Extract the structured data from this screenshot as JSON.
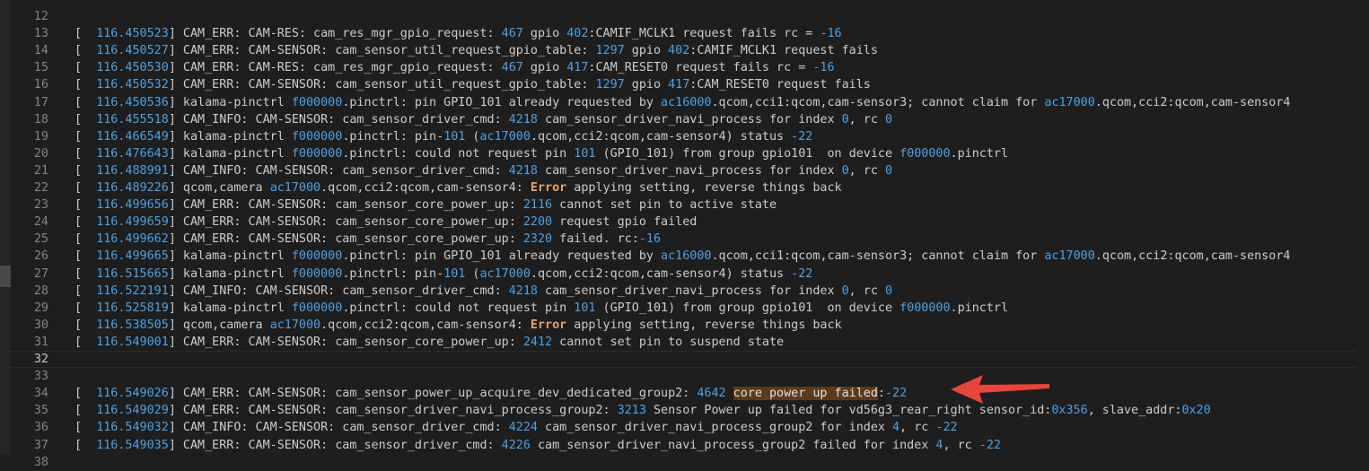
{
  "editor": {
    "lines": [
      {
        "n": "12",
        "segs": []
      },
      {
        "n": "13",
        "segs": [
          [
            "[  ",
            "t"
          ],
          [
            "116.450523",
            "n"
          ],
          [
            "] CAM_ERR: CAM-RES: cam_res_mgr_gpio_request: ",
            "t"
          ],
          [
            "467",
            "n"
          ],
          [
            " gpio ",
            "t"
          ],
          [
            "402",
            "n"
          ],
          [
            ":CAMIF_MCLK1 request fails rc = ",
            "t"
          ],
          [
            "-16",
            "n"
          ]
        ]
      },
      {
        "n": "14",
        "segs": [
          [
            "[  ",
            "t"
          ],
          [
            "116.450527",
            "n"
          ],
          [
            "] CAM_ERR: CAM-SENSOR: cam_sensor_util_request_gpio_table: ",
            "t"
          ],
          [
            "1297",
            "n"
          ],
          [
            " gpio ",
            "t"
          ],
          [
            "402",
            "n"
          ],
          [
            ":CAMIF_MCLK1 request fails",
            "t"
          ]
        ]
      },
      {
        "n": "15",
        "segs": [
          [
            "[  ",
            "t"
          ],
          [
            "116.450530",
            "n"
          ],
          [
            "] CAM_ERR: CAM-RES: cam_res_mgr_gpio_request: ",
            "t"
          ],
          [
            "467",
            "n"
          ],
          [
            " gpio ",
            "t"
          ],
          [
            "417",
            "n"
          ],
          [
            ":CAM_RESET0 request fails rc = ",
            "t"
          ],
          [
            "-16",
            "n"
          ]
        ]
      },
      {
        "n": "16",
        "segs": [
          [
            "[  ",
            "t"
          ],
          [
            "116.450532",
            "n"
          ],
          [
            "] CAM_ERR: CAM-SENSOR: cam_sensor_util_request_gpio_table: ",
            "t"
          ],
          [
            "1297",
            "n"
          ],
          [
            " gpio ",
            "t"
          ],
          [
            "417",
            "n"
          ],
          [
            ":CAM_RESET0 request fails",
            "t"
          ]
        ]
      },
      {
        "n": "17",
        "segs": [
          [
            "[  ",
            "t"
          ],
          [
            "116.450536",
            "n"
          ],
          [
            "] kalama-pinctrl ",
            "t"
          ],
          [
            "f000000",
            "n"
          ],
          [
            ".pinctrl: pin GPIO_101 already requested by ",
            "t"
          ],
          [
            "ac16000",
            "n"
          ],
          [
            ".qcom,cci1:qcom,cam-sensor3; cannot claim for ",
            "t"
          ],
          [
            "ac17000",
            "n"
          ],
          [
            ".qcom,cci2:qcom,cam-sensor4",
            "t"
          ]
        ]
      },
      {
        "n": "18",
        "segs": [
          [
            "[  ",
            "t"
          ],
          [
            "116.455518",
            "n"
          ],
          [
            "] CAM_INFO: CAM-SENSOR: cam_sensor_driver_cmd: ",
            "t"
          ],
          [
            "4218",
            "n"
          ],
          [
            " cam_sensor_driver_navi_process for index ",
            "t"
          ],
          [
            "0",
            "n"
          ],
          [
            ", rc ",
            "t"
          ],
          [
            "0",
            "n"
          ]
        ]
      },
      {
        "n": "19",
        "segs": [
          [
            "[  ",
            "t"
          ],
          [
            "116.466549",
            "n"
          ],
          [
            "] kalama-pinctrl ",
            "t"
          ],
          [
            "f000000",
            "n"
          ],
          [
            ".pinctrl: pin-",
            "t"
          ],
          [
            "101",
            "n"
          ],
          [
            " (",
            "t"
          ],
          [
            "ac17000",
            "n"
          ],
          [
            ".qcom,cci2:qcom,cam-sensor4) status ",
            "t"
          ],
          [
            "-22",
            "n"
          ]
        ]
      },
      {
        "n": "20",
        "segs": [
          [
            "[  ",
            "t"
          ],
          [
            "116.476643",
            "n"
          ],
          [
            "] kalama-pinctrl ",
            "t"
          ],
          [
            "f000000",
            "n"
          ],
          [
            ".pinctrl: could not request pin ",
            "t"
          ],
          [
            "101",
            "n"
          ],
          [
            " (GPIO_101) from group gpio101  on device ",
            "t"
          ],
          [
            "f000000",
            "n"
          ],
          [
            ".pinctrl",
            "t"
          ]
        ]
      },
      {
        "n": "21",
        "segs": [
          [
            "[  ",
            "t"
          ],
          [
            "116.488991",
            "n"
          ],
          [
            "] CAM_INFO: CAM-SENSOR: cam_sensor_driver_cmd: ",
            "t"
          ],
          [
            "4218",
            "n"
          ],
          [
            " cam_sensor_driver_navi_process for index ",
            "t"
          ],
          [
            "0",
            "n"
          ],
          [
            ", rc ",
            "t"
          ],
          [
            "0",
            "n"
          ]
        ]
      },
      {
        "n": "22",
        "segs": [
          [
            "[  ",
            "t"
          ],
          [
            "116.489226",
            "n"
          ],
          [
            "] qcom,camera ",
            "t"
          ],
          [
            "ac17000",
            "n"
          ],
          [
            ".qcom,cci2:qcom,cam-sensor4: ",
            "t"
          ],
          [
            "Error",
            "e"
          ],
          [
            " applying setting, reverse things back",
            "t"
          ]
        ]
      },
      {
        "n": "23",
        "segs": [
          [
            "[  ",
            "t"
          ],
          [
            "116.499656",
            "n"
          ],
          [
            "] CAM_ERR: CAM-SENSOR: cam_sensor_core_power_up: ",
            "t"
          ],
          [
            "2116",
            "n"
          ],
          [
            " cannot set pin to active state",
            "t"
          ]
        ]
      },
      {
        "n": "24",
        "segs": [
          [
            "[  ",
            "t"
          ],
          [
            "116.499659",
            "n"
          ],
          [
            "] CAM_ERR: CAM-SENSOR: cam_sensor_core_power_up: ",
            "t"
          ],
          [
            "2200",
            "n"
          ],
          [
            " request gpio failed",
            "t"
          ]
        ]
      },
      {
        "n": "25",
        "segs": [
          [
            "[  ",
            "t"
          ],
          [
            "116.499662",
            "n"
          ],
          [
            "] CAM_ERR: CAM-SENSOR: cam_sensor_core_power_up: ",
            "t"
          ],
          [
            "2320",
            "n"
          ],
          [
            " failed. rc:",
            "t"
          ],
          [
            "-16",
            "n"
          ]
        ]
      },
      {
        "n": "26",
        "segs": [
          [
            "[  ",
            "t"
          ],
          [
            "116.499665",
            "n"
          ],
          [
            "] kalama-pinctrl ",
            "t"
          ],
          [
            "f000000",
            "n"
          ],
          [
            ".pinctrl: pin GPIO_101 already requested by ",
            "t"
          ],
          [
            "ac16000",
            "n"
          ],
          [
            ".qcom,cci1:qcom,cam-sensor3; cannot claim for ",
            "t"
          ],
          [
            "ac17000",
            "n"
          ],
          [
            ".qcom,cci2:qcom,cam-sensor4",
            "t"
          ]
        ]
      },
      {
        "n": "27",
        "segs": [
          [
            "[  ",
            "t"
          ],
          [
            "116.515665",
            "n"
          ],
          [
            "] kalama-pinctrl ",
            "t"
          ],
          [
            "f000000",
            "n"
          ],
          [
            ".pinctrl: pin-",
            "t"
          ],
          [
            "101",
            "n"
          ],
          [
            " (",
            "t"
          ],
          [
            "ac17000",
            "n"
          ],
          [
            ".qcom,cci2:qcom,cam-sensor4) status ",
            "t"
          ],
          [
            "-22",
            "n"
          ]
        ]
      },
      {
        "n": "28",
        "segs": [
          [
            "[  ",
            "t"
          ],
          [
            "116.522191",
            "n"
          ],
          [
            "] CAM_INFO: CAM-SENSOR: cam_sensor_driver_cmd: ",
            "t"
          ],
          [
            "4218",
            "n"
          ],
          [
            " cam_sensor_driver_navi_process for index ",
            "t"
          ],
          [
            "0",
            "n"
          ],
          [
            ", rc ",
            "t"
          ],
          [
            "0",
            "n"
          ]
        ]
      },
      {
        "n": "29",
        "segs": [
          [
            "[  ",
            "t"
          ],
          [
            "116.525819",
            "n"
          ],
          [
            "] kalama-pinctrl ",
            "t"
          ],
          [
            "f000000",
            "n"
          ],
          [
            ".pinctrl: could not request pin ",
            "t"
          ],
          [
            "101",
            "n"
          ],
          [
            " (GPIO_101) from group gpio101  on device ",
            "t"
          ],
          [
            "f000000",
            "n"
          ],
          [
            ".pinctrl",
            "t"
          ]
        ]
      },
      {
        "n": "30",
        "segs": [
          [
            "[  ",
            "t"
          ],
          [
            "116.538505",
            "n"
          ],
          [
            "] qcom,camera ",
            "t"
          ],
          [
            "ac17000",
            "n"
          ],
          [
            ".qcom,cci2:qcom,cam-sensor4: ",
            "t"
          ],
          [
            "Error",
            "e"
          ],
          [
            " applying setting, reverse things back",
            "t"
          ]
        ]
      },
      {
        "n": "31",
        "segs": [
          [
            "[  ",
            "t"
          ],
          [
            "116.549001",
            "n"
          ],
          [
            "] CAM_ERR: CAM-SENSOR: cam_sensor_core_power_up: ",
            "t"
          ],
          [
            "2412",
            "n"
          ],
          [
            " cannot set pin to suspend state",
            "t"
          ]
        ]
      },
      {
        "n": "32",
        "segs": [],
        "current": true
      },
      {
        "n": "33",
        "segs": []
      },
      {
        "n": "34",
        "segs": [
          [
            "[  ",
            "t"
          ],
          [
            "116.549026",
            "n"
          ],
          [
            "] CAM_ERR: CAM-SENSOR: cam_sensor_power_up_acquire_dev_dedicated_group2: ",
            "t"
          ],
          [
            "4642",
            "n"
          ],
          [
            " ",
            "t"
          ],
          [
            "core power up failed",
            "h"
          ],
          [
            ":",
            "t"
          ],
          [
            "-22",
            "n"
          ]
        ]
      },
      {
        "n": "35",
        "segs": [
          [
            "[  ",
            "t"
          ],
          [
            "116.549029",
            "n"
          ],
          [
            "] CAM_ERR: CAM-SENSOR: cam_sensor_driver_navi_process_group2: ",
            "t"
          ],
          [
            "3213",
            "n"
          ],
          [
            " Sensor Power up failed for vd56g3_rear_right sensor_id:",
            "t"
          ],
          [
            "0x356",
            "n"
          ],
          [
            ", slave_addr:",
            "t"
          ],
          [
            "0x20",
            "n"
          ]
        ]
      },
      {
        "n": "36",
        "segs": [
          [
            "[  ",
            "t"
          ],
          [
            "116.549032",
            "n"
          ],
          [
            "] CAM_INFO: CAM-SENSOR: cam_sensor_driver_cmd: ",
            "t"
          ],
          [
            "4224",
            "n"
          ],
          [
            " cam_sensor_driver_navi_process_group2 for index ",
            "t"
          ],
          [
            "4",
            "n"
          ],
          [
            ", rc ",
            "t"
          ],
          [
            "-22",
            "n"
          ]
        ]
      },
      {
        "n": "37",
        "segs": [
          [
            "[  ",
            "t"
          ],
          [
            "116.549035",
            "n"
          ],
          [
            "] CAM_ERR: CAM-SENSOR: cam_sensor_driver_cmd: ",
            "t"
          ],
          [
            "4226",
            "n"
          ],
          [
            " cam_sensor_driver_navi_process_group2 failed for index ",
            "t"
          ],
          [
            "4",
            "n"
          ],
          [
            ", rc ",
            "t"
          ],
          [
            "-22",
            "n"
          ]
        ]
      },
      {
        "n": "38",
        "segs": []
      }
    ]
  },
  "annotation": {
    "arrow_color": "#e8453c",
    "arrow_icon": "red-arrow-icon"
  },
  "colors": {
    "background": "#1e1e1e",
    "number": "#4fa0e0",
    "error_keyword": "#e5a16a",
    "highlight": "#5b3a1d"
  }
}
